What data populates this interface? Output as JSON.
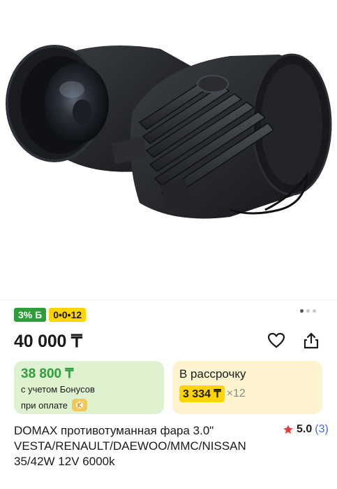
{
  "badges": {
    "bonus": "3% Б",
    "installment": "0•0•12"
  },
  "gallery": {
    "image_alt": "DOMAX противотуманная фара 3.0\"",
    "dots": 3,
    "active_dot": 0
  },
  "price": {
    "current": "40 000 ₸"
  },
  "bonus_card": {
    "price": "38 800 ₸",
    "line1": "с учетом Бонусов",
    "line2": "при оплате"
  },
  "credit_card": {
    "title": "В рассрочку",
    "amount": "3 334 ₸",
    "months": "×12"
  },
  "product": {
    "title": "DOMAX противотуманная фара 3.0\" VESTA/RENAULT/DAEWOO/MMC/NISSAN 35/42W 12V 6000k"
  },
  "rating": {
    "value": "5.0",
    "count": "(3)"
  },
  "icons": {
    "favorite": "heart-icon",
    "share": "share-icon",
    "star": "star-icon",
    "payment": "kaspi-pay-icon"
  },
  "colors": {
    "bonus_green": "#2e9e3b",
    "installment_yellow": "#ffd500",
    "bonus_card_bg": "#dff2cf",
    "credit_card_bg": "#fdf4cf",
    "star_red": "#e53935",
    "link_blue": "#3e6fd8"
  }
}
